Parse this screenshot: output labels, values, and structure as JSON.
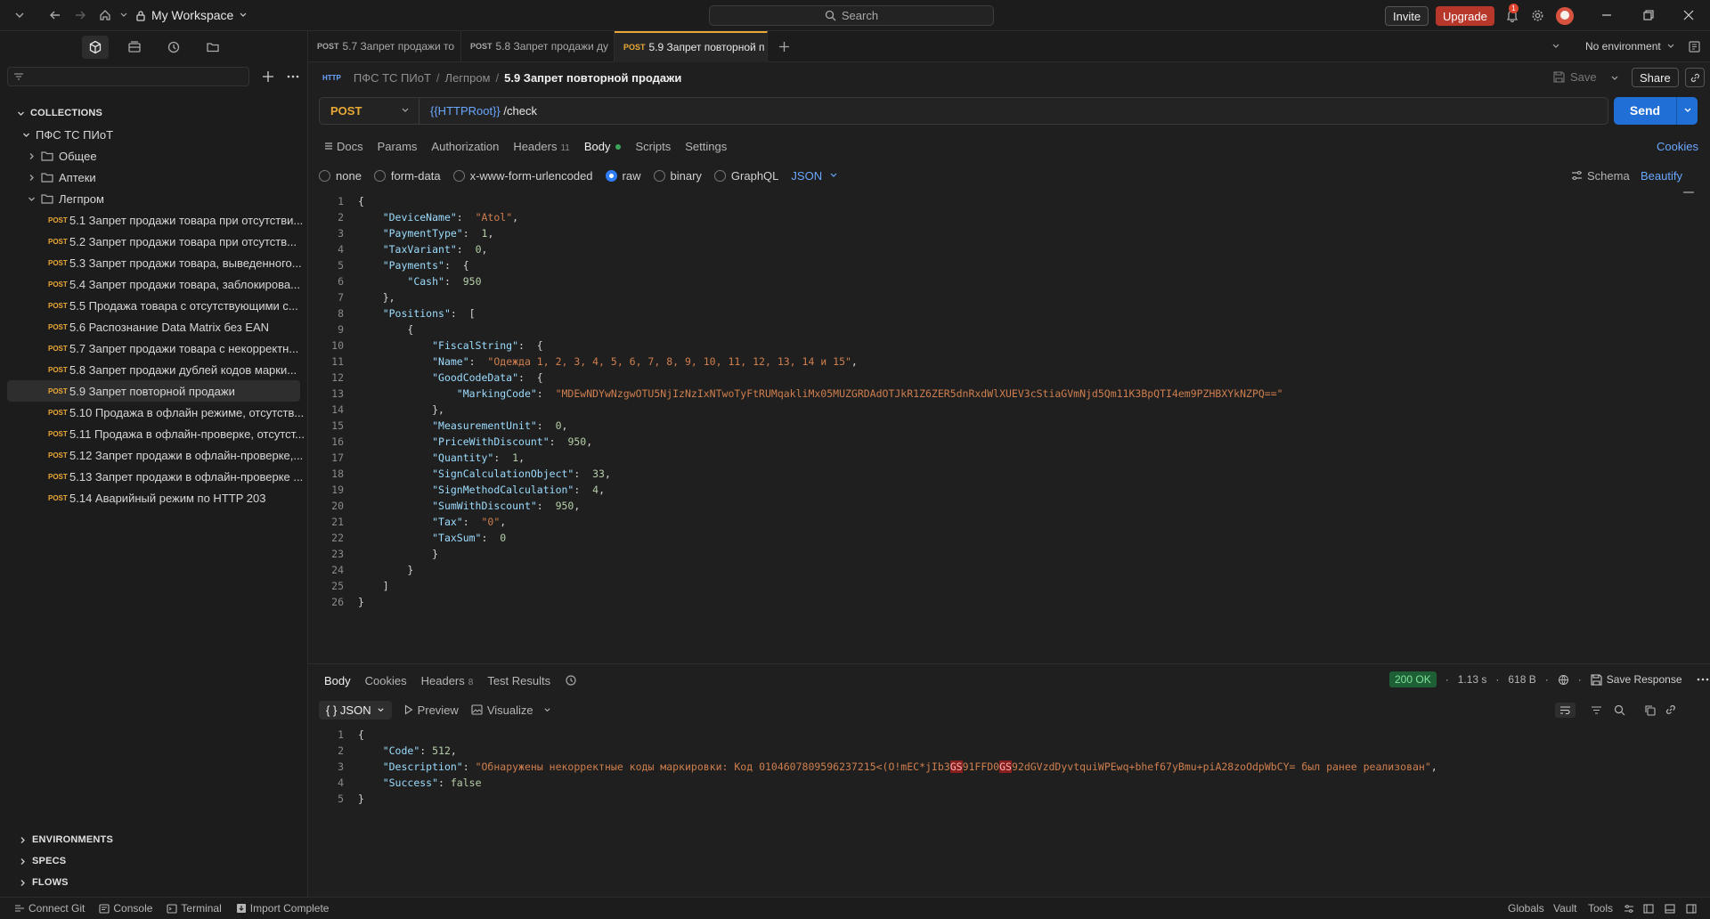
{
  "topbar": {
    "workspace": "My Workspace",
    "search_placeholder": "Search",
    "invite": "Invite",
    "upgrade": "Upgrade",
    "notif_count": "1"
  },
  "sidebar": {
    "collections_label": "COLLECTIONS",
    "collection_name": "ПФС ТС ПИоТ",
    "folders": [
      "Общее",
      "Аптеки",
      "Легпром"
    ],
    "requests": [
      {
        "method": "POST",
        "label": "5.1 Запрет продажи товара при отсутстви..."
      },
      {
        "method": "POST",
        "label": "5.2 Запрет продажи товара при отсутств..."
      },
      {
        "method": "POST",
        "label": "5.3 Запрет продажи товара, выведенного..."
      },
      {
        "method": "POST",
        "label": "5.4 Запрет продажи товара, заблокирова..."
      },
      {
        "method": "POST",
        "label": "5.5 Продажа товара с отсутствующими с..."
      },
      {
        "method": "POST",
        "label": "5.6 Распознание Data Matrix без EAN"
      },
      {
        "method": "POST",
        "label": "5.7 Запрет продажи товара с некорректн..."
      },
      {
        "method": "POST",
        "label": "5.8 Запрет продажи дублей кодов марки..."
      },
      {
        "method": "POST",
        "label": "5.9 Запрет повторной продажи"
      },
      {
        "method": "POST",
        "label": "5.10 Продажа в офлайн режиме, отсутств..."
      },
      {
        "method": "POST",
        "label": "5.11 Продажа в офлайн-проверке, отсутст..."
      },
      {
        "method": "POST",
        "label": "5.12 Запрет продажи в офлайн-проверке,..."
      },
      {
        "method": "POST",
        "label": "5.13 Запрет продажи в офлайн-проверке ..."
      },
      {
        "method": "POST",
        "label": "5.14 Аварийный режим по HTTP 203"
      }
    ],
    "environments": "ENVIRONMENTS",
    "specs": "SPECS",
    "flows": "FLOWS"
  },
  "tabs": [
    {
      "method": "POST",
      "label": "5.7 Запрет продажи то"
    },
    {
      "method": "POST",
      "label": "5.8 Запрет продажи ду"
    },
    {
      "method": "POST",
      "label": "5.9 Запрет повторной п"
    }
  ],
  "environment": "No environment",
  "breadcrumb": {
    "root": "ПФС ТС ПИоТ",
    "folder": "Легпром",
    "current": "5.9 Запрет повторной продажи"
  },
  "actions": {
    "save": "Save",
    "share": "Share"
  },
  "request": {
    "method": "POST",
    "url_var": "{{HTTPRoot}}",
    "url_path": " /check",
    "send": "Send"
  },
  "req_tabs": {
    "docs": "Docs",
    "params": "Params",
    "auth": "Authorization",
    "headers": "Headers",
    "headers_count": "11",
    "body": "Body",
    "scripts": "Scripts",
    "settings": "Settings",
    "cookies": "Cookies"
  },
  "body_modes": {
    "none": "none",
    "form_data": "form-data",
    "urlencoded": "x-www-form-urlencoded",
    "raw": "raw",
    "binary": "binary",
    "graphql": "GraphQL",
    "format": "JSON",
    "schema": "Schema",
    "beautify": "Beautify"
  },
  "request_body": [
    "{",
    "    \"DeviceName\":  \"Atol\",",
    "    \"PaymentType\":  1,",
    "    \"TaxVariant\":  0,",
    "    \"Payments\":  {",
    "        \"Cash\":  950",
    "    },",
    "    \"Positions\":  [",
    "        {",
    "            \"FiscalString\":  {",
    "            \"Name\":  \"Одежда 1, 2, 3, 4, 5, 6, 7, 8, 9, 10, 11, 12, 13, 14 и 15\",",
    "            \"GoodCodeData\":  {",
    "                \"MarkingCode\":  \"MDEwNDYwNzgwOTU5NjIzNzIxNTwoTyFtRUMqakliMx05MUZGRDAdOTJkR1Z6ZER5dnRxdWlXUEV3cStiaGVmNjd5Qm11K3BpQTI4em9PZHBXYkNZPQ==\"",
    "            },",
    "            \"MeasurementUnit\":  0,",
    "            \"PriceWithDiscount\":  950,",
    "            \"Quantity\":  1,",
    "            \"SignCalculationObject\":  33,",
    "            \"SignMethodCalculation\":  4,",
    "            \"SumWithDiscount\":  950,",
    "            \"Tax\":  \"0\",",
    "            \"TaxSum\":  0",
    "            }",
    "        }",
    "    ]",
    "}"
  ],
  "response": {
    "tabs": {
      "body": "Body",
      "cookies": "Cookies",
      "headers": "Headers",
      "headers_count": "8",
      "tests": "Test Results"
    },
    "status": "200 OK",
    "time": "1.13 s",
    "size": "618 B",
    "save_response": "Save Response",
    "format": "{ } JSON",
    "preview": "Preview",
    "visualize": "Visualize",
    "lines": [
      "{",
      "    \"Code\": 512,",
      "    \"Description\": \"Обнаружены некорректные коды маркировки: Код 0104607809596237215<(O!mEC*jIb3␝91FFD0␝92dGVzdDyvtquiWPEwq+bhef67yBmu+piA28zoOdpWbCY= был ранее реализован\",",
      "    \"Success\": false",
      "}"
    ]
  },
  "statusbar": {
    "git": "Connect Git",
    "console": "Console",
    "terminal": "Terminal",
    "import": "Import Complete",
    "globals": "Globals",
    "vault": "Vault",
    "tools": "Tools"
  },
  "colors": {
    "accent": "#e9a936",
    "primary": "#1f6fd6",
    "upgrade": "#b8372b",
    "ok": "#1f5f35"
  }
}
